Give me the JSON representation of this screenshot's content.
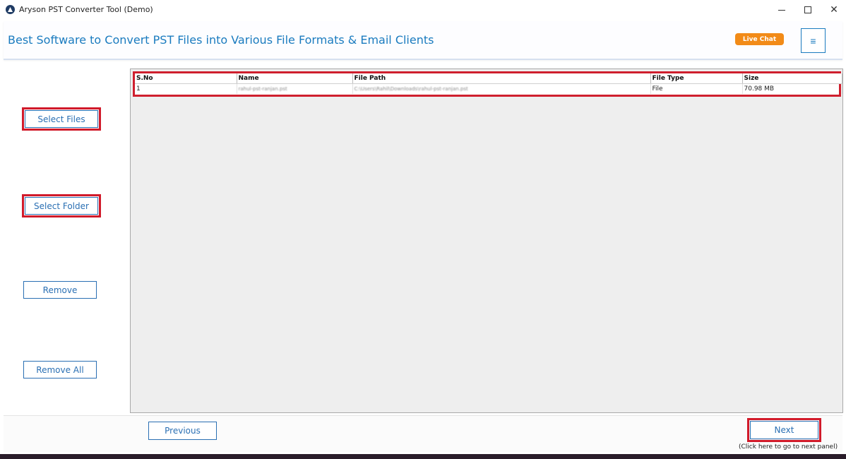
{
  "window": {
    "title": "Aryson PST Converter Tool (Demo)",
    "controls": {
      "minimize": "",
      "maximize": "",
      "close": "✕"
    }
  },
  "header": {
    "title": "Best Software to Convert PST Files into Various File Formats & Email Clients",
    "live_chat": "Live Chat",
    "menu_icon": "≡"
  },
  "sidebar": {
    "select_files": "Select Files",
    "select_folder": "Select Folder",
    "remove": "Remove",
    "remove_all": "Remove All"
  },
  "table": {
    "columns": [
      "S.No",
      "Name",
      "File Path",
      "File Type",
      "Size"
    ],
    "rows": [
      {
        "sno": "1",
        "name": "rahul-pst-ranjan.pst",
        "path": "C:\\Users\\Rahil\\Downloads\\rahul-pst-ranjan.pst",
        "type": "File",
        "size": "70.98 MB"
      }
    ]
  },
  "footer": {
    "previous": "Previous",
    "next": "Next",
    "next_hint": "(Click here to go to next panel)"
  },
  "colors": {
    "accent": "#1a7bbf",
    "button_border": "#2a6fb3",
    "highlight": "#d11a2a",
    "live_chat": "#f28b18",
    "panel_bg": "#eeeeee"
  }
}
